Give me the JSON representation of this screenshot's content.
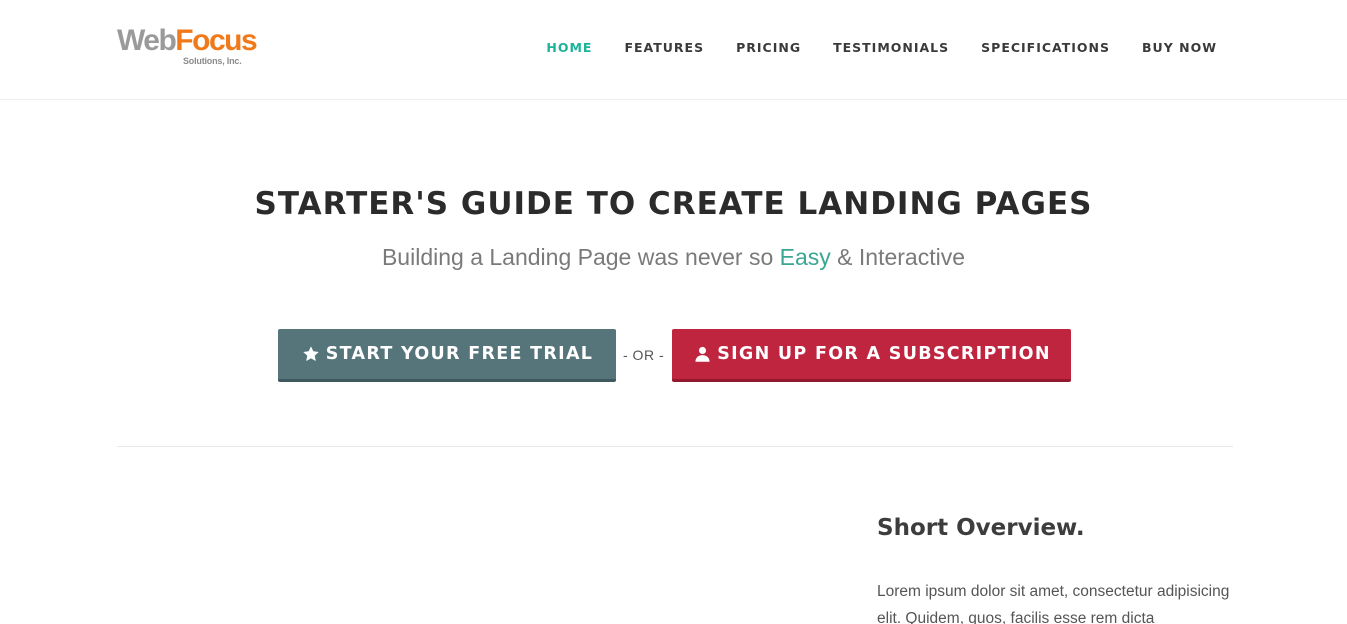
{
  "logo": {
    "word1": "Web",
    "word2": "Focus",
    "tagline": "Solutions, Inc."
  },
  "nav": {
    "items": [
      {
        "label": "HOME",
        "active": true
      },
      {
        "label": "FEATURES",
        "active": false
      },
      {
        "label": "PRICING",
        "active": false
      },
      {
        "label": "TESTIMONIALS",
        "active": false
      },
      {
        "label": "SPECIFICATIONS",
        "active": false
      },
      {
        "label": "BUY NOW",
        "active": false
      }
    ]
  },
  "hero": {
    "title": "STARTER'S GUIDE TO CREATE LANDING PAGES",
    "subtitle_before": "Building a Landing Page was never so ",
    "subtitle_accent": "Easy",
    "subtitle_after": " & Interactive"
  },
  "cta": {
    "trial_label": "START YOUR FREE TRIAL",
    "trial_icon": "star-icon",
    "or_text": "- OR -",
    "subscribe_label": "SIGN UP FOR A SUBSCRIPTION",
    "subscribe_icon": "user-icon"
  },
  "overview": {
    "title": "Short Overview.",
    "text": "Lorem ipsum dolor sit amet, consectetur adipisicing elit. Quidem, quos, facilis esse rem dicta"
  },
  "colors": {
    "accent": "#1bb39a",
    "trial_button": "#55757a",
    "subscribe_button": "#c0253f",
    "logo_orange": "#f07a1a"
  }
}
